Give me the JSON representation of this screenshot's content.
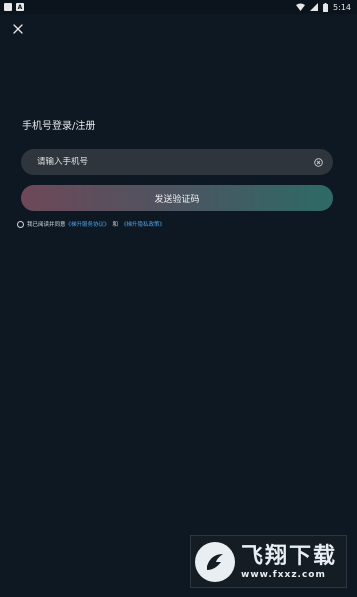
{
  "status_bar": {
    "notification_label": "A",
    "time": "5:14"
  },
  "header": {
    "close_icon": "close-icon"
  },
  "login": {
    "title": "手机号登录/注册",
    "phone_placeholder": "请输入手机号",
    "phone_value": "",
    "send_code_label": "发送验证码"
  },
  "agreement": {
    "prefix": "我已阅读并同意",
    "terms_link": "《梯升服务协议》",
    "and": "和",
    "privacy_link": "《梯升隐私政策》"
  },
  "watermark": {
    "name": "飞翔下载",
    "url": "www.fxxz.com"
  },
  "colors": {
    "background": "#0e1822",
    "field": "#2e353c",
    "button_gradient_start": "#6e4858",
    "button_gradient_end": "#2d6a66",
    "link": "#4ea3e8"
  }
}
